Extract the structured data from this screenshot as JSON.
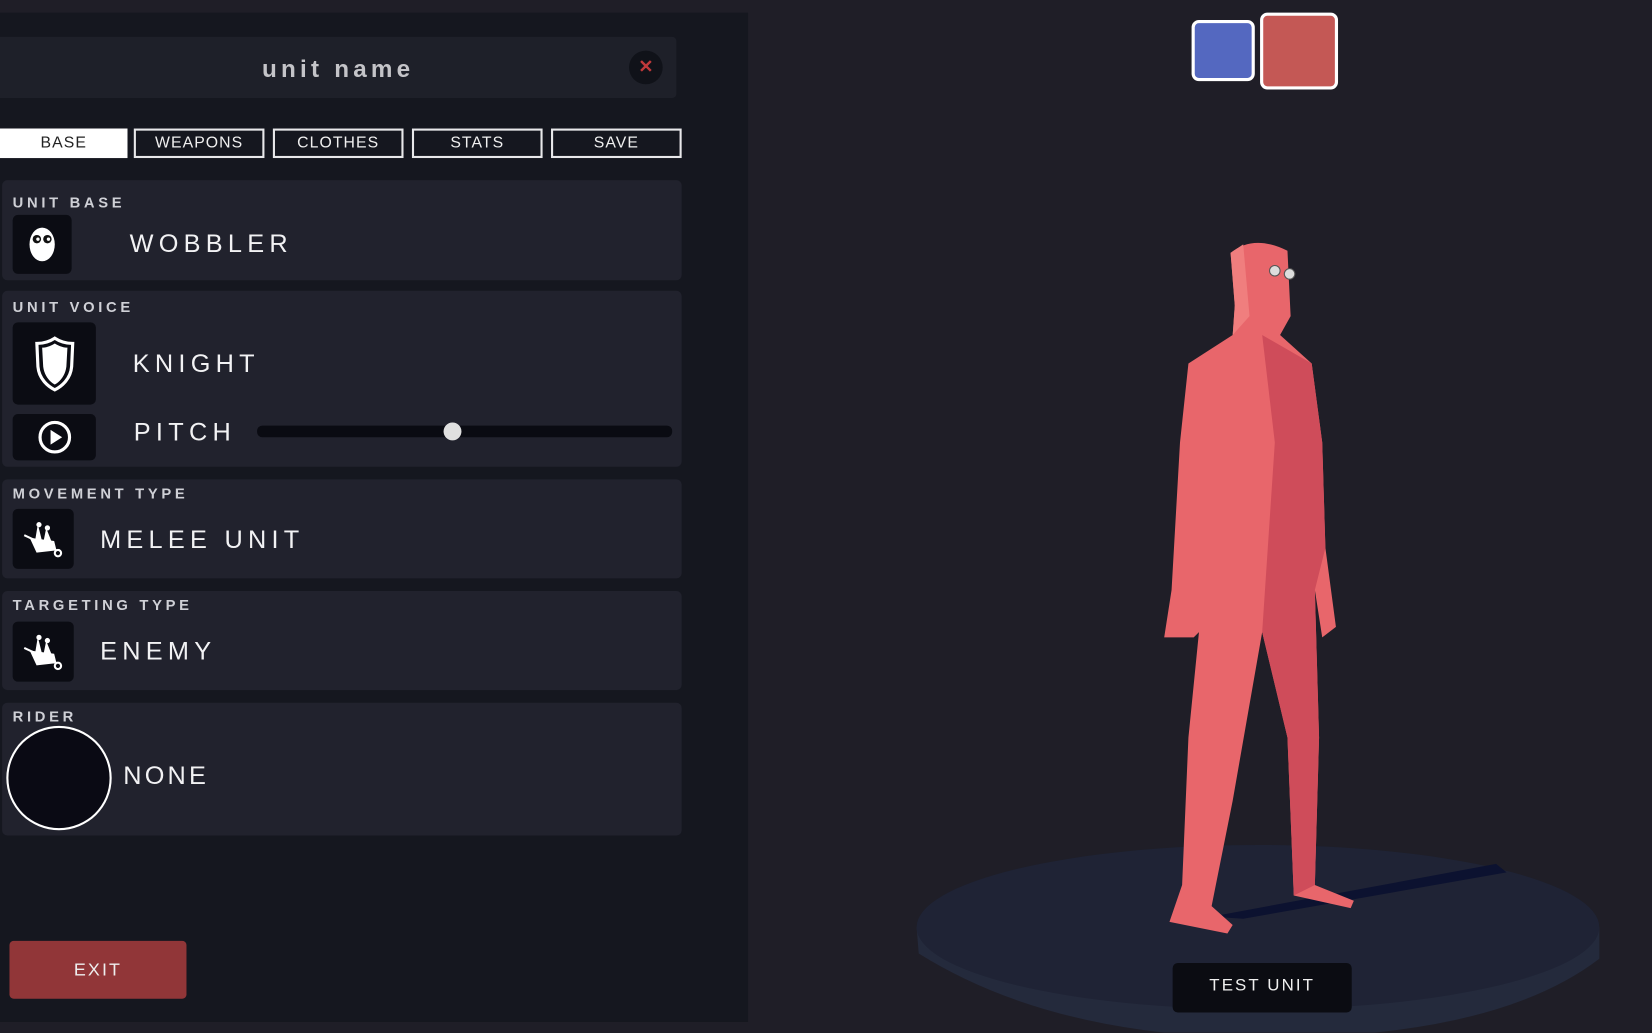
{
  "header": {
    "unit_name": "unit name",
    "close_icon": "close-x-icon"
  },
  "tabs": [
    {
      "label": "BASE",
      "active": true
    },
    {
      "label": "WEAPONS"
    },
    {
      "label": "CLOTHES"
    },
    {
      "label": "STATS"
    },
    {
      "label": "SAVE"
    }
  ],
  "sections": {
    "unit_base": {
      "label": "UNIT BASE",
      "value": "WOBBLER",
      "icon": "wobbler-face-icon"
    },
    "unit_voice": {
      "label": "UNIT VOICE",
      "value": "KNIGHT",
      "icon": "shield-icon",
      "pitch_label": "PITCH",
      "pitch_value": 0.47,
      "play_icon": "play-icon"
    },
    "movement_type": {
      "label": "MOVEMENT TYPE",
      "value": "MELEE UNIT",
      "icon": "wheelbarrow-icon"
    },
    "targeting_type": {
      "label": "TARGETING TYPE",
      "value": "ENEMY",
      "icon": "wheelbarrow-icon"
    },
    "rider": {
      "label": "RIDER",
      "value": "NONE"
    }
  },
  "exit_label": "EXIT",
  "test_unit_label": "TEST UNIT",
  "team_colors": [
    "#5468c0",
    "#c45855"
  ],
  "selected_team": 1,
  "colors": {
    "unit_body": "#e85f63",
    "exit": "#913638"
  }
}
